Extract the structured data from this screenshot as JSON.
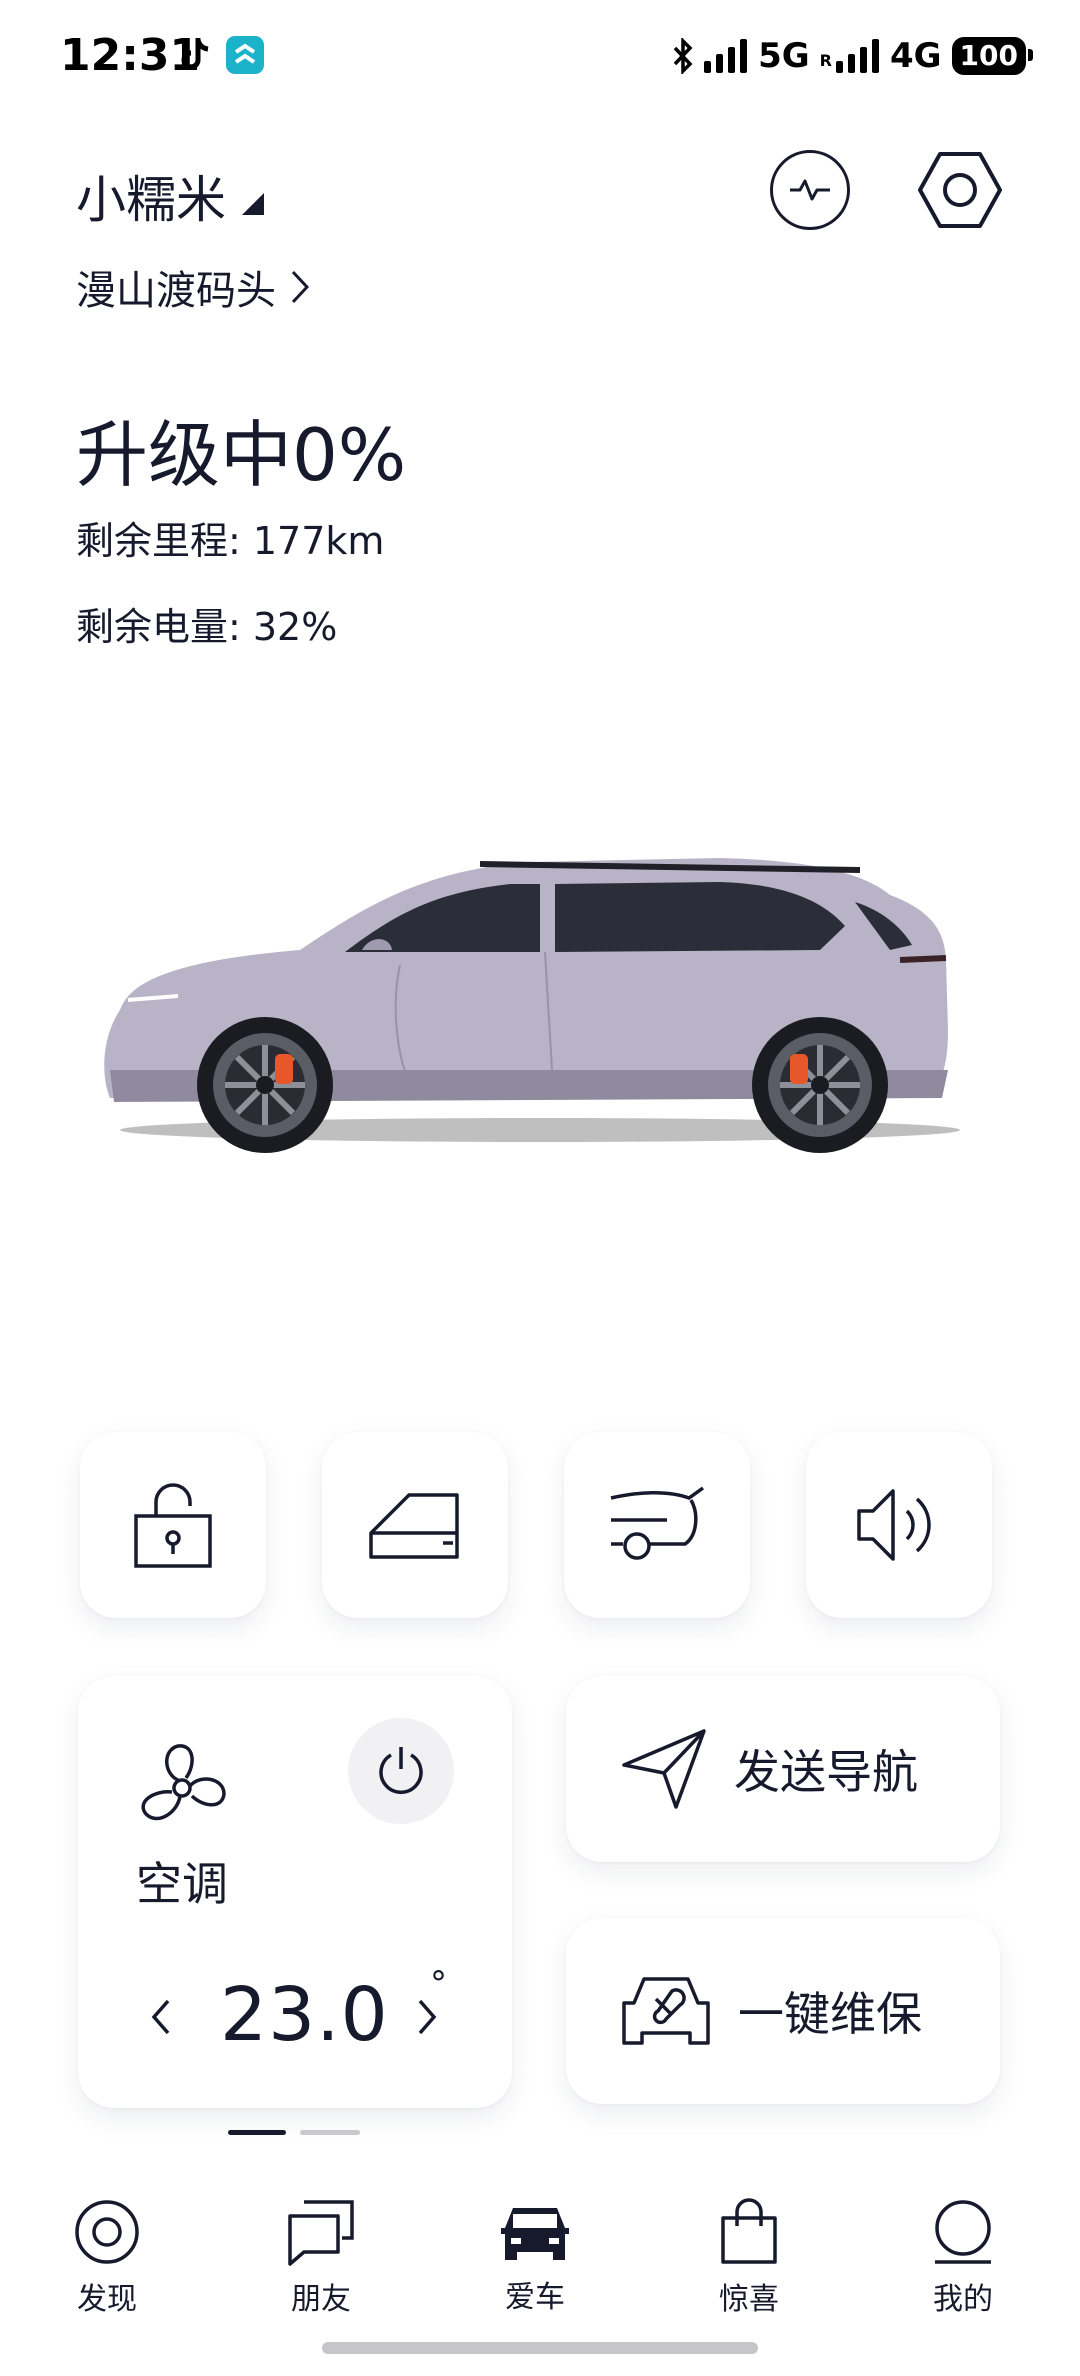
{
  "status_bar": {
    "time": "12:31",
    "network_primary": "5G",
    "roaming_mark": "R",
    "network_secondary": "4G",
    "battery": "100",
    "icons": [
      "tiktok-icon",
      "app-icon",
      "bluetooth-icon",
      "signal-icon",
      "signal-icon"
    ]
  },
  "header": {
    "car_name": "小糯米",
    "location": "漫山渡码头",
    "diagnostics_icon": "pulse-icon",
    "settings_icon": "hex-nut-icon"
  },
  "vehicle_status": {
    "title": "升级中0%",
    "range_text": "剩余里程: 177km",
    "battery_text": "剩余电量: 32%"
  },
  "quick_controls": [
    {
      "name": "lock",
      "icon": "unlock-icon"
    },
    {
      "name": "door",
      "icon": "car-door-icon"
    },
    {
      "name": "tailgate",
      "icon": "tailgate-icon"
    },
    {
      "name": "horn",
      "icon": "speaker-icon"
    }
  ],
  "climate": {
    "label": "空调",
    "temperature": "23.0",
    "degree_symbol": "°",
    "icon": "fan-icon",
    "power_icon": "power-icon"
  },
  "actions": {
    "send_navigation": "发送导航",
    "one_click_maintenance": "一键维保"
  },
  "pager": {
    "pages": 2,
    "active": 1
  },
  "tabs": [
    {
      "label": "发现",
      "icon": "discover-icon",
      "active": false
    },
    {
      "label": "朋友",
      "icon": "chat-icon",
      "active": false
    },
    {
      "label": "爱车",
      "icon": "car-icon",
      "active": true
    },
    {
      "label": "惊喜",
      "icon": "shopping-bag-icon",
      "active": false
    },
    {
      "label": "我的",
      "icon": "profile-icon",
      "active": false
    }
  ],
  "colors": {
    "text": "#161a2c",
    "car_body": "#b8b3c6",
    "caliper": "#e8572a",
    "pager_active": "#161a2c",
    "pager_inactive": "#c9c9cc"
  }
}
